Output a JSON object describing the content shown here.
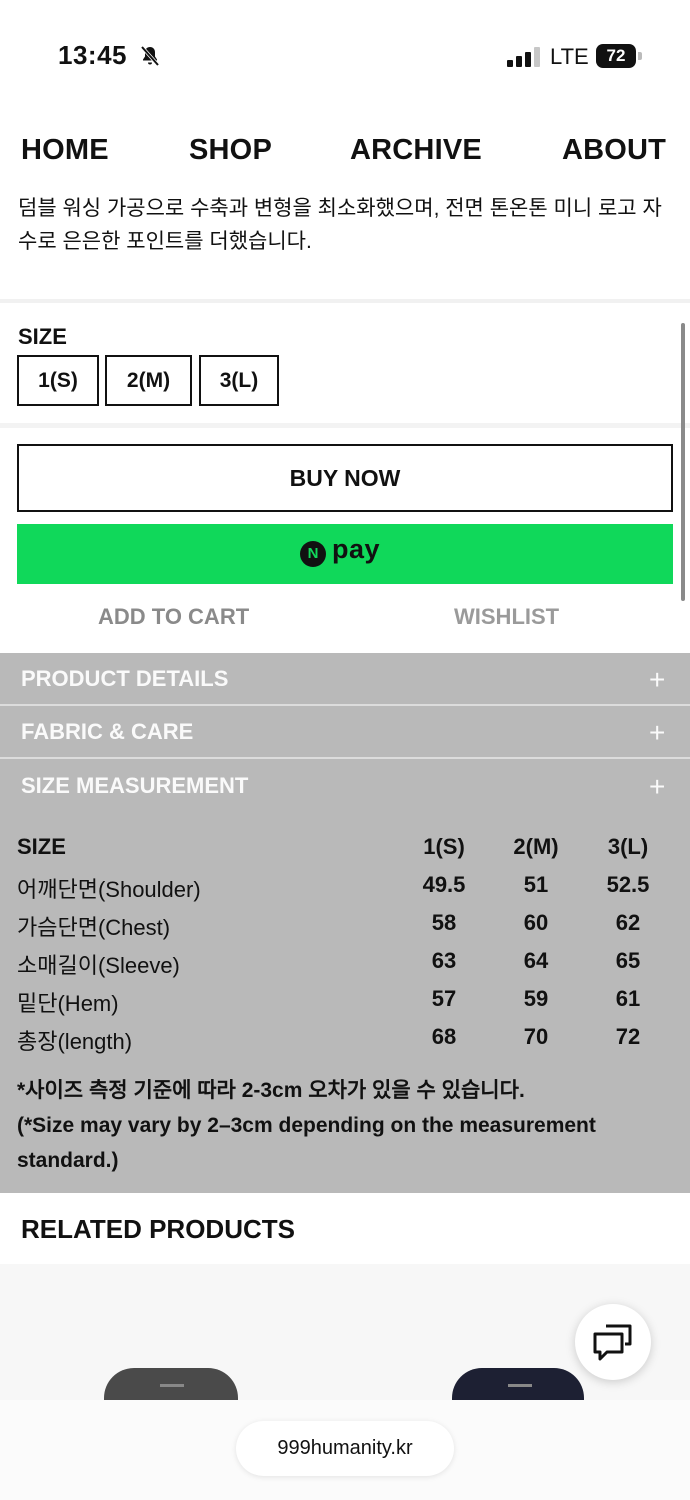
{
  "status_bar": {
    "time": "13:45",
    "network": "LTE",
    "battery": "72",
    "icons": [
      "bell-slash-icon",
      "signal-icon",
      "battery-icon"
    ]
  },
  "nav": {
    "home": "HOME",
    "shop": "SHOP",
    "archive": "ARCHIVE",
    "about": "ABOUT"
  },
  "product": {
    "description": "덤블 워싱 가공으로 수축과 변형을 최소화했으며, 전면 톤온톤 미니 로고 자수로 은은한 포인트를 더했습니다."
  },
  "size_selector": {
    "label": "SIZE",
    "options": [
      "1(S)",
      "2(M)",
      "3(L)"
    ]
  },
  "actions": {
    "buy_now": "BUY NOW",
    "npay_logo": "N",
    "npay_text": "pay",
    "add_to_cart": "ADD TO CART",
    "wishlist": "WISHLIST"
  },
  "accordions": {
    "product_details": "PRODUCT DETAILS",
    "fabric_care": "FABRIC & CARE",
    "size_measurement": "SIZE MEASUREMENT",
    "toggle": "+"
  },
  "size_table": {
    "header": [
      "SIZE",
      "1(S)",
      "2(M)",
      "3(L)"
    ],
    "rows": [
      [
        "어깨단면(Shoulder)",
        "49.5",
        "51",
        "52.5"
      ],
      [
        "가슴단면(Chest)",
        "58",
        "60",
        "62"
      ],
      [
        "소매길이(Sleeve)",
        "63",
        "64",
        "65"
      ],
      [
        "밑단(Hem)",
        "57",
        "59",
        "61"
      ],
      [
        "총장(length)",
        "68",
        "70",
        "72"
      ]
    ],
    "note_ko": "*사이즈 측정 기준에 따라 2-3cm 오차가 있을 수 있습니다.",
    "note_en": "(*Size may vary by 2–3cm depending on the measurement standard.)"
  },
  "related": {
    "title": "RELATED PRODUCTS"
  },
  "browser": {
    "url": "999humanity.kr"
  },
  "colors": {
    "npay_green": "#10d85a",
    "accordion_gray": "#b9b9b9"
  }
}
